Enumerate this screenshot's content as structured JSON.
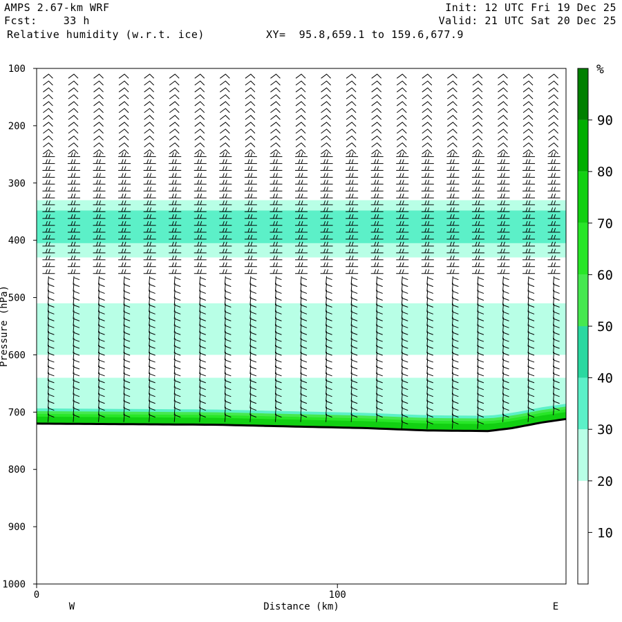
{
  "header": {
    "model": "AMPS 2.67-km WRF",
    "init": "Init: 12 UTC Fri 19 Dec 25",
    "fcst": "Fcst:    33 h",
    "valid": "Valid: 21 UTC Sat 20 Dec 25",
    "field": "Relative humidity (w.r.t. ice)",
    "xy": "XY=  95.8,659.1 to 159.6,677.9"
  },
  "chart_data": {
    "type": "heatmap",
    "xlabel": "Distance (km)",
    "ylabel": "Pressure (hPa)",
    "xlim": [
      0,
      176
    ],
    "ylim": [
      1000,
      100
    ],
    "x_ticks": [
      0,
      100
    ],
    "y_ticks": [
      100,
      200,
      300,
      400,
      500,
      600,
      700,
      800,
      900,
      1000
    ],
    "x_end_labels": {
      "left": "W",
      "right": "E"
    },
    "colorbar": {
      "unit": "%",
      "levels": [
        0,
        10,
        20,
        30,
        40,
        50,
        60,
        70,
        80,
        90,
        100
      ],
      "tick_labels": [
        10,
        20,
        30,
        40,
        50,
        60,
        70,
        80,
        90
      ],
      "colors": [
        "#ffffff",
        "#ffffff",
        "#ffffff",
        "#b8ffe6",
        "#5cf0c8",
        "#2ad8a0",
        "#46e850",
        "#28e628",
        "#12d012",
        "#00ae00",
        "#008000"
      ]
    },
    "terrain_surface": [
      {
        "x": 0,
        "p": 720
      },
      {
        "x": 60,
        "p": 722
      },
      {
        "x": 110,
        "p": 728
      },
      {
        "x": 130,
        "p": 732
      },
      {
        "x": 150,
        "p": 733
      },
      {
        "x": 158,
        "p": 728
      },
      {
        "x": 168,
        "p": 718
      },
      {
        "x": 176,
        "p": 712
      }
    ],
    "humidity_layers": [
      {
        "name": "upper_moist_band",
        "p_top": 330,
        "p_bottom": 430,
        "rh": 35
      },
      {
        "name": "upper_moist_core",
        "p_top": 348,
        "p_bottom": 405,
        "rh": 45
      },
      {
        "name": "mid_moist_band",
        "p_top": 510,
        "p_bottom": 600,
        "rh": 35
      },
      {
        "name": "lower_moist_band",
        "p_top": 640,
        "p_bottom": 700,
        "rh": 35
      },
      {
        "name": "near_surface",
        "p_top": 680,
        "p_bottom": 735,
        "rh": 80
      }
    ],
    "grid": false,
    "legend": "right"
  }
}
